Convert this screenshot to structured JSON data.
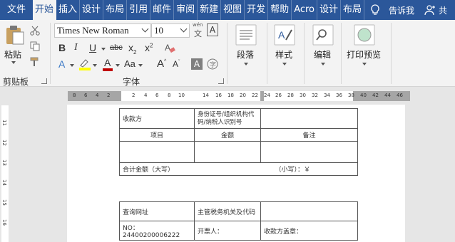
{
  "tabs": [
    "文件",
    "开始",
    "插入",
    "设计",
    "布局",
    "引用",
    "邮件",
    "审阅",
    "新建",
    "视图",
    "开发",
    "帮助",
    "Acro",
    "设计",
    "布局"
  ],
  "active_tab": "开始",
  "tell_me": "告诉我",
  "share": "共",
  "clipboard": {
    "paste": "粘贴",
    "group": "剪贴板"
  },
  "font": {
    "name": "Times New Roman",
    "size": "10",
    "group": "字体",
    "phonetic": "wén"
  },
  "paragraph": {
    "label": "段落"
  },
  "styles": {
    "label": "样式"
  },
  "editing": {
    "label": "编辑"
  },
  "print_preview": {
    "label": "打印预览"
  },
  "ruler_numbers": [
    "8",
    "6",
    "4",
    "2",
    "2",
    "4",
    "6",
    "8",
    "10",
    "14",
    "16",
    "18",
    "20",
    "22",
    "24",
    "26",
    "28",
    "30",
    "32",
    "34",
    "36",
    "38",
    "40",
    "42",
    "44",
    "46"
  ],
  "vruler_numbers": [
    "11",
    "12",
    "13",
    "14",
    "15",
    "16"
  ],
  "table1": {
    "payee": "收款方",
    "id_label": "身份证号/组织机构代码/纳税人识别号",
    "col_item": "项目",
    "col_amount": "金额",
    "col_remark": "备注",
    "total_label": "合计金额（大写）",
    "small_label": "（小写）：￥"
  },
  "table2": {
    "query_url": "查询网址",
    "tax_office": "主管税务机关及代码",
    "no_label": "NO：24400200006222",
    "issuer": "开票人：",
    "payee_seal": "收款方盖章："
  },
  "colors": {
    "accent": "#2b579a",
    "ribbon": "#f3f3f3",
    "highlight": "#ffff00",
    "font_color": "#c00000"
  }
}
